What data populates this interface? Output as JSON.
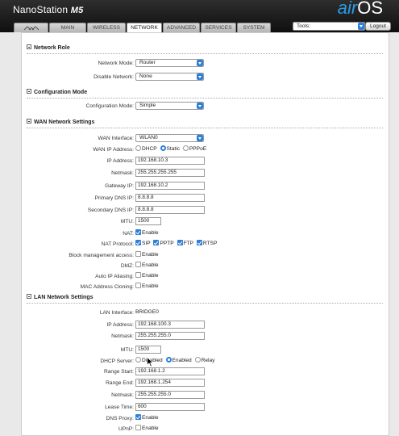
{
  "header": {
    "brand_name": "NanoStation",
    "brand_model": "M5",
    "logo_air": "air",
    "logo_os": "OS",
    "tabs": [
      {
        "label": "",
        "icon": "ubnt-logo-icon"
      },
      {
        "label": "MAIN"
      },
      {
        "label": "WIRELESS"
      },
      {
        "label": "NETWORK",
        "active": true
      },
      {
        "label": "ADVANCED"
      },
      {
        "label": "SERVICES"
      },
      {
        "label": "SYSTEM"
      }
    ],
    "tools_select": "Tools:",
    "logout": "Logout"
  },
  "network_role": {
    "title": "Network Role",
    "network_mode_label": "Network Mode:",
    "network_mode_value": "Router",
    "disable_network_label": "Disable Network:",
    "disable_network_value": "None"
  },
  "configuration_mode": {
    "title": "Configuration Mode",
    "label": "Configuration Mode:",
    "value": "Simple"
  },
  "wan": {
    "title": "WAN Network Settings",
    "interface_label": "WAN Interface:",
    "interface_value": "WLAN0",
    "ip_mode_label": "WAN IP Address:",
    "ip_mode_options": [
      "DHCP",
      "Static",
      "PPPoE"
    ],
    "ip_mode_selected": "Static",
    "ip_label": "IP Address:",
    "ip_value": "192.168.10.3",
    "netmask_label": "Netmask:",
    "netmask_value": "255.255.255.255",
    "gateway_label": "Gateway IP:",
    "gateway_value": "192.168.10.2",
    "dns1_label": "Primary DNS IP:",
    "dns1_value": "8.8.8.8",
    "dns2_label": "Secondary DNS IP:",
    "dns2_value": "8.8.8.8",
    "mtu_label": "MTU:",
    "mtu_value": "1500",
    "nat_label": "NAT:",
    "nat_option": "Enable",
    "nat_protocol_label": "NAT Protocol:",
    "nat_protocols": [
      "SIP",
      "PPTP",
      "FTP",
      "RTSP"
    ],
    "block_mgmt_label": "Block management access:",
    "block_mgmt_option": "Enable",
    "dmz_label": "DMZ:",
    "dmz_option": "Enable",
    "auto_ip_label": "Auto IP Aliasing:",
    "auto_ip_option": "Enable",
    "mac_clone_label": "MAC Address Cloning:",
    "mac_clone_option": "Enable"
  },
  "lan": {
    "title": "LAN Network Settings",
    "interface_label": "LAN Interface:",
    "interface_value": "BRIDGE0",
    "ip_label": "IP Address:",
    "ip_value": "192.168.100.3",
    "netmask_label": "Netmask:",
    "netmask_value": "255.255.255.0",
    "mtu_label": "MTU:",
    "mtu_value": "1500",
    "dhcp_label": "DHCP Server:",
    "dhcp_options": [
      "Disabled",
      "Enabled",
      "Relay"
    ],
    "dhcp_selected": "Enabled",
    "range_start_label": "Range Start:",
    "range_start_value": "192.168.1.2",
    "range_end_label": "Range End:",
    "range_end_value": "192.168.1.254",
    "dhcp_netmask_label": "Netmask:",
    "dhcp_netmask_value": "255.255.255.0",
    "lease_label": "Lease Time:",
    "lease_value": "600",
    "dns_proxy_label": "DNS Proxy:",
    "dns_proxy_option": "Enable",
    "upnp_label": "UPnP:",
    "upnp_option": "Enable"
  },
  "colors": {
    "accent": "#2d7fd8",
    "header_bg": "#1a1a1a",
    "logo_air": "#2b9be6"
  }
}
